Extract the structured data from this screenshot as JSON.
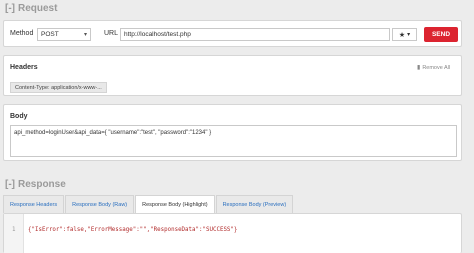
{
  "request": {
    "toggle": "[-]",
    "title": "Request",
    "method_label": "Method",
    "method_value": "POST",
    "url_label": "URL",
    "url_value": "http://localhost/test.php",
    "star_icon": "star-icon",
    "send_label": "SEND"
  },
  "headers": {
    "title": "Headers",
    "remove_all": "Remove All",
    "items": [
      "Content-Type: application/x-www-..."
    ]
  },
  "body": {
    "title": "Body",
    "value": "api_method=loginUser&api_data={ \"username\":\"test\", \"password\":\"1234\" }"
  },
  "response": {
    "toggle": "[-]",
    "title": "Response",
    "tabs": [
      {
        "label": "Response Headers"
      },
      {
        "label": "Response Body (Raw)"
      },
      {
        "label": "Response Body (Highlight)"
      },
      {
        "label": "Response Body (Preview)"
      }
    ],
    "active_tab": 2,
    "line_number": "1",
    "code": "{\"IsError\":false,\"ErrorMessage\":\"\",\"ResponseData\":\"SUCCESS\"}"
  },
  "colors": {
    "send": "#dc2430",
    "link": "#2a6fbf"
  }
}
